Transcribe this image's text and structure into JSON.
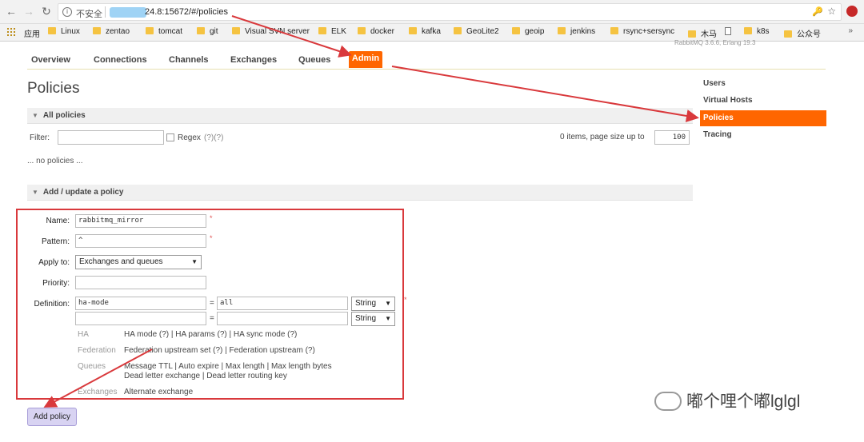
{
  "browser": {
    "insecure_label": "不安全",
    "url": "24.8:15672/#/policies",
    "bookmarks": [
      "应用",
      "Linux",
      "zentao",
      "tomcat",
      "git",
      "Visual SVN server",
      "ELK",
      "docker",
      "kafka",
      "GeoLite2",
      "geoip",
      "jenkins",
      "rsync+sersync",
      "木马",
      "k8s",
      "公众号"
    ],
    "more": "»"
  },
  "header": {
    "version_text": "RabbitMQ 3.6.6, Erlang 19.3",
    "tabs": [
      "Overview",
      "Connections",
      "Channels",
      "Exchanges",
      "Queues",
      "Admin"
    ]
  },
  "page": {
    "title": "Policies",
    "all_policies": "All policies",
    "filter_label": "Filter:",
    "regex_label": "Regex",
    "regex_help": "(?)(?)",
    "pagesize_label": "0 items, page size up to",
    "pagesize_value": "100",
    "no_policies": "... no policies ...",
    "add_update": "Add / update a policy"
  },
  "sidebar": {
    "items": [
      "Users",
      "Virtual Hosts",
      "Policies",
      "Tracing"
    ],
    "active": "Policies"
  },
  "form": {
    "name_label": "Name:",
    "name_value": "rabbitmq_mirror",
    "pattern_label": "Pattern:",
    "pattern_value": "^",
    "apply_label": "Apply to:",
    "apply_value": "Exchanges and queues",
    "priority_label": "Priority:",
    "priority_value": "",
    "definition_label": "Definition:",
    "def_key": "ha-mode",
    "def_value": "all",
    "type1": "String",
    "type2": "String",
    "eq": "=",
    "required": "*",
    "help": {
      "ha": "HA",
      "ha_text": "HA mode (?) | HA params (?) | HA sync mode (?)",
      "federation": "Federation",
      "federation_text": "Federation upstream set (?) | Federation upstream (?)",
      "queues": "Queues",
      "queues_text1": "Message TTL | Auto expire | Max length | Max length bytes",
      "queues_text2": "Dead letter exchange | Dead letter routing key",
      "exchanges": "Exchanges",
      "exchanges_text": "Alternate exchange"
    },
    "submit": "Add policy"
  },
  "watermark": "嘟个哩个嘟lglgl",
  "colors": {
    "accent": "#ff6600",
    "annotation": "#d9393c",
    "button": "#d8d3f2"
  },
  "icons": [
    "back-icon",
    "forward-icon",
    "reload-icon",
    "info-icon",
    "key-icon",
    "star-icon",
    "apps-icon",
    "folder-icon",
    "page-icon",
    "triangle-down-icon",
    "wechat-icon"
  ]
}
